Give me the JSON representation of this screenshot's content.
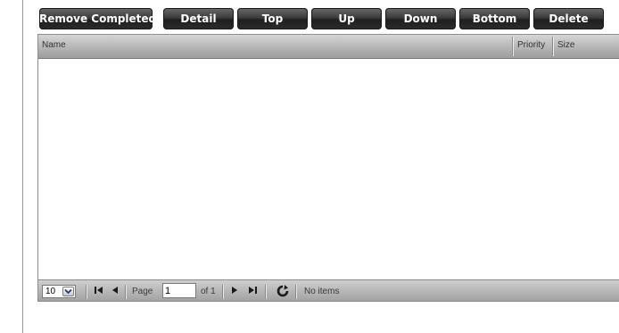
{
  "toolbar": {
    "buttons": [
      {
        "label": "Remove Completed"
      },
      {
        "label": "Detail"
      },
      {
        "label": "Top"
      },
      {
        "label": "Up"
      },
      {
        "label": "Down"
      },
      {
        "label": "Bottom"
      },
      {
        "label": "Delete"
      }
    ]
  },
  "grid": {
    "columns": [
      {
        "label": "Name"
      },
      {
        "label": "Priority"
      },
      {
        "label": "Size"
      }
    ],
    "rows": []
  },
  "pager": {
    "rows_per_page": "10",
    "page_label": "Page",
    "current_page": "1",
    "of_label": "of 1",
    "status": "No items"
  },
  "icons": {
    "first": "first-page-icon",
    "prev": "previous-page-icon",
    "next": "next-page-icon",
    "last": "last-page-icon",
    "reload": "reload-icon",
    "dropdown": "chevron-down-icon"
  }
}
